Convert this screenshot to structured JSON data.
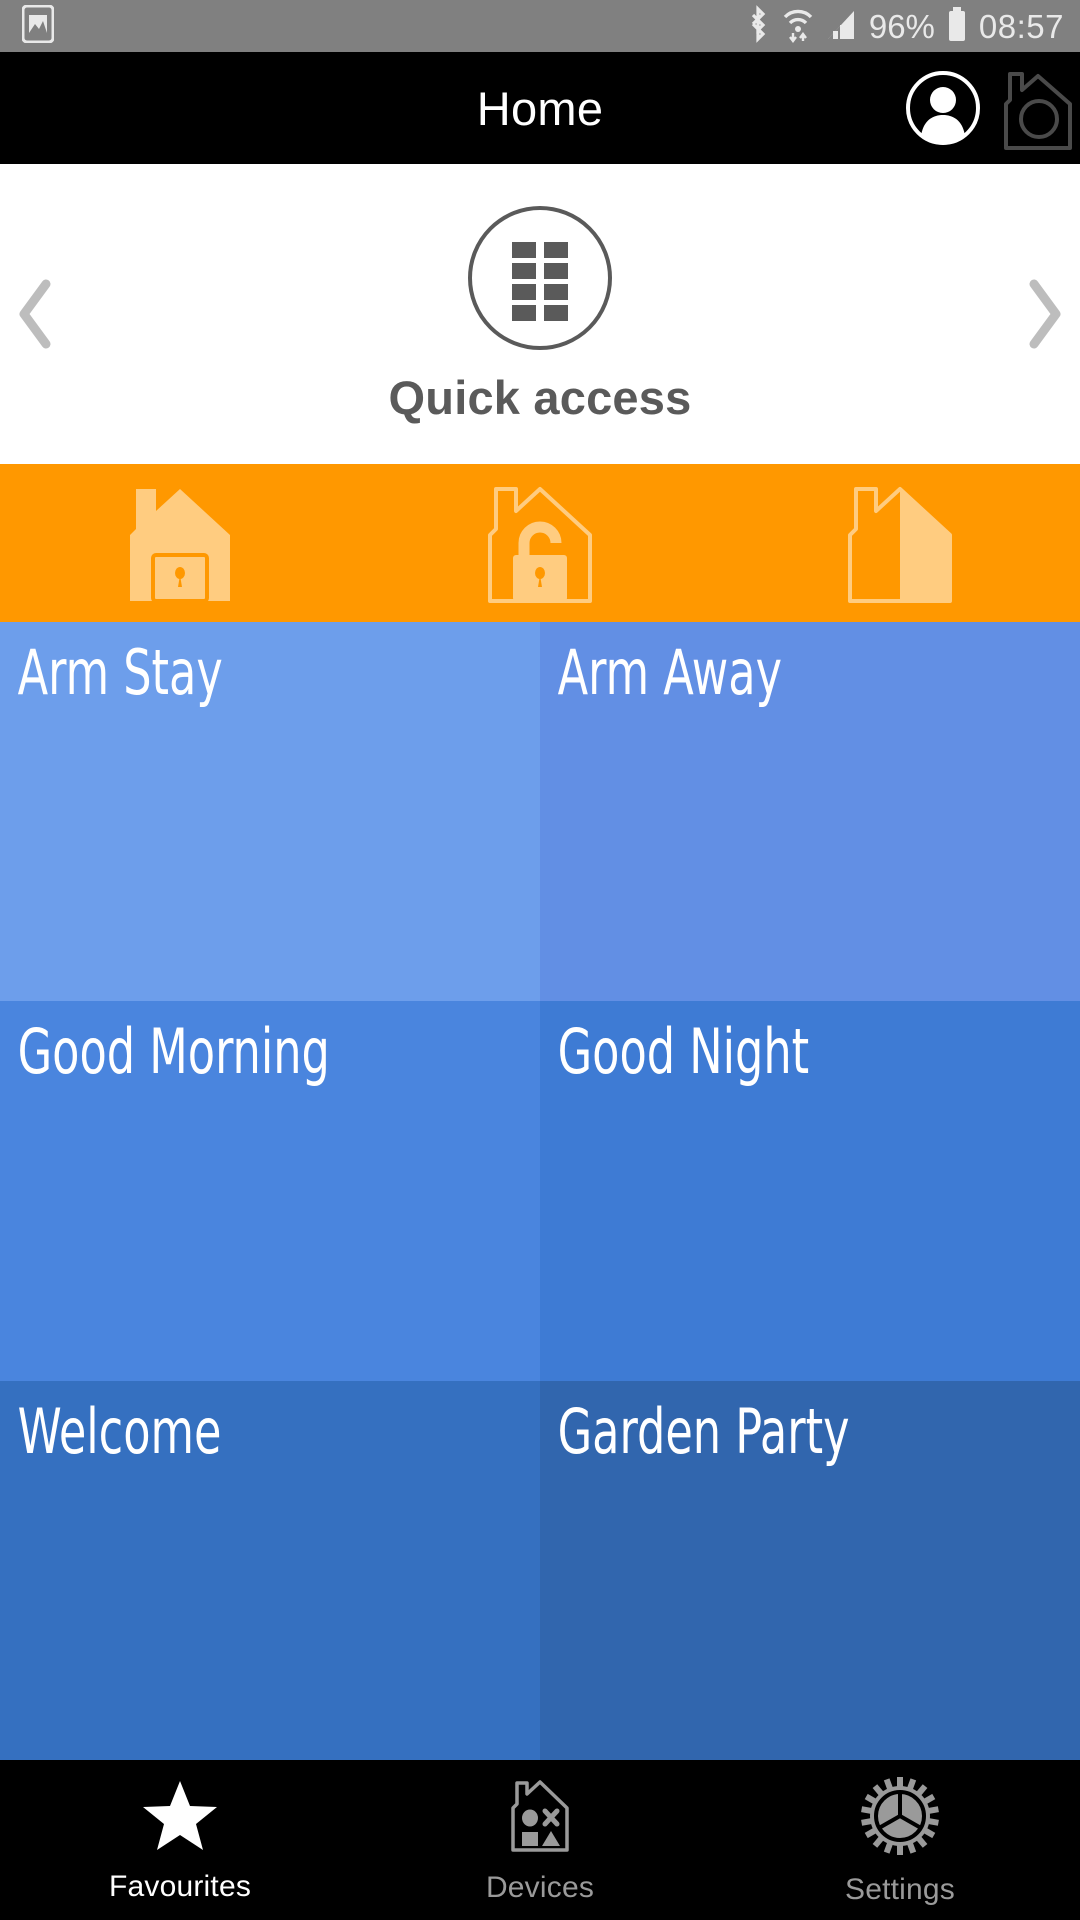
{
  "status_bar": {
    "left_icon": "screenshot-icon",
    "bluetooth_icon": "bluetooth-icon",
    "wifi_icon": "wifi-data-icon",
    "signal_icon": "cellular-signal-icon",
    "battery_percent": "96%",
    "battery_icon": "battery-icon",
    "clock": "08:57",
    "background": "#808080",
    "foreground": "#e9e9e9"
  },
  "header": {
    "title": "Home",
    "background": "#000000",
    "avatar_icon": "user-avatar-icon",
    "house_icon": "house-camera-icon"
  },
  "carousel": {
    "icon": "grid-squares-icon",
    "label": "Quick access",
    "prev_icon": "chevron-left-icon",
    "next_icon": "chevron-right-icon",
    "label_color": "#5a5a5a",
    "background": "#ffffff"
  },
  "mode_band": {
    "background": "#FF9800",
    "icon_fill": "#FFCC80",
    "modes": [
      {
        "name": "armed-stay",
        "icon": "house-locked-filled-icon"
      },
      {
        "name": "armed-away",
        "icon": "house-unlocked-outline-icon"
      },
      {
        "name": "disarmed",
        "icon": "house-split-icon"
      }
    ]
  },
  "scenes": {
    "rows": [
      [
        {
          "label": "Arm Stay",
          "color": "#6D9EEB"
        },
        {
          "label": "Arm Away",
          "color": "#628FE4"
        }
      ],
      [
        {
          "label": "Good Morning",
          "color": "#4A85DE"
        },
        {
          "label": "Good Night",
          "color": "#3E7BD4"
        }
      ],
      [
        {
          "label": "Welcome",
          "color": "#3570C0"
        },
        {
          "label": "Garden Party",
          "color": "#3166AE"
        }
      ]
    ],
    "label_color": "#ffffff"
  },
  "bottom_nav": {
    "background": "#000000",
    "items": [
      {
        "label": "Favourites",
        "icon": "star-icon",
        "active": true
      },
      {
        "label": "Devices",
        "icon": "house-devices-icon",
        "active": false
      },
      {
        "label": "Settings",
        "icon": "gear-icon",
        "active": false
      }
    ],
    "active_color": "#ffffff",
    "inactive_color": "#9a9a9a"
  }
}
